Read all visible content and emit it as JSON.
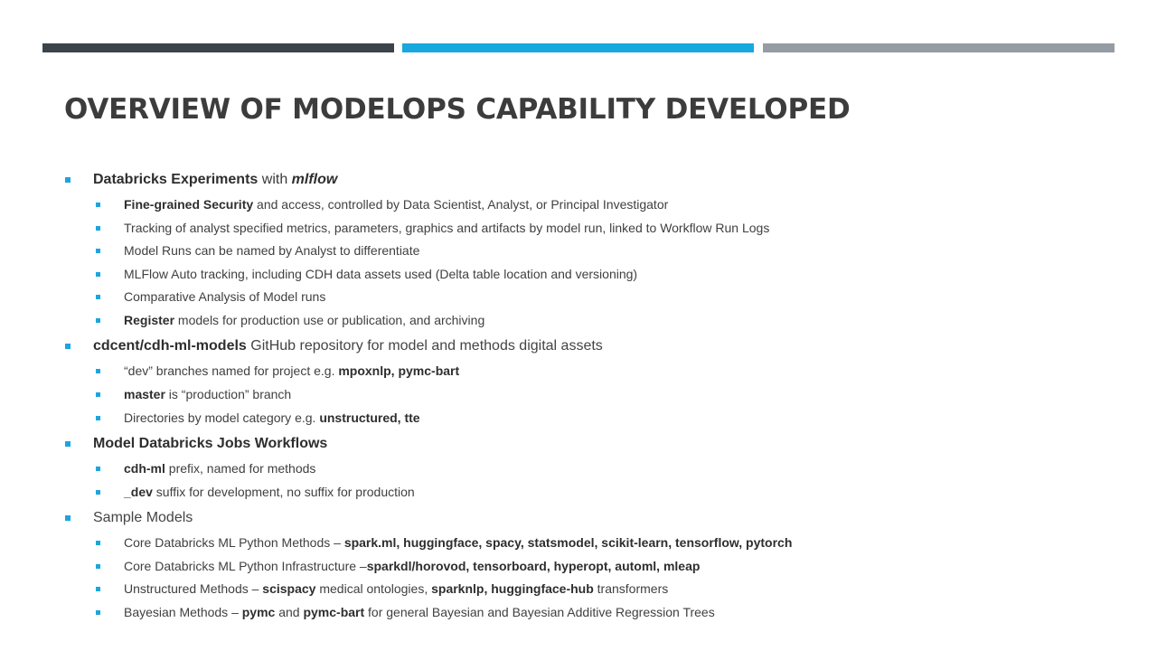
{
  "slide": {
    "title": "OVERVIEW OF MODELOPS CAPABILITY DEVELOPED",
    "accent_colors": [
      "#3d4449",
      "#17a8e0",
      "#959ca3"
    ],
    "bullet_color": "#1aa6de"
  },
  "sections": [
    {
      "heading": {
        "bold": "Databricks Experiments",
        "rest": " with ",
        "em": "mlflow"
      },
      "items": [
        {
          "bold": "Fine-grained Security",
          "rest": " and access, controlled by Data Scientist, Analyst, or Principal Investigator"
        },
        {
          "rest": "Tracking of analyst specified metrics, parameters, graphics and artifacts by model run, linked to Workflow Run Logs"
        },
        {
          "rest": "Model Runs can be named by Analyst to differentiate"
        },
        {
          "rest": "MLFlow Auto tracking, including  CDH data assets used (Delta table location and versioning)"
        },
        {
          "rest": "Comparative Analysis of Model runs"
        },
        {
          "bold": "Register",
          "rest": " models for production use or publication, and archiving"
        }
      ]
    },
    {
      "heading": {
        "bold": "cdcent/cdh-ml-models",
        "rest": " GitHub repository for model and methods digital assets"
      },
      "items": [
        {
          "pre": "“dev” branches named for project e.g. ",
          "bold": "mpoxnlp, pymc-bart"
        },
        {
          "bold": "master",
          "rest": " is “production” branch"
        },
        {
          "pre": "Directories by model category e.g. ",
          "bold": "unstructured, tte"
        }
      ]
    },
    {
      "heading": {
        "bold": "Model Databricks Jobs Workflows"
      },
      "items": [
        {
          "bold": "cdh-ml",
          "rest": " prefix, named for methods"
        },
        {
          "bold": "_dev",
          "rest": " suffix for development, no suffix for production"
        }
      ]
    },
    {
      "heading": {
        "rest": "Sample Models"
      },
      "items": [
        {
          "pre": "Core Databricks ML Python Methods – ",
          "bold": "spark.ml, huggingface, spacy, statsmodel, scikit-learn, tensorflow, pytorch"
        },
        {
          "pre": "Core Databricks ML Python Infrastructure –",
          "bold": "sparkdl/horovod, tensorboard, hyperopt, automl, mleap"
        },
        {
          "pre": "Unstructured Methods – ",
          "bold": "scispacy",
          "mid": " medical ontologies, ",
          "bold2": "sparknlp, huggingface-hub",
          "rest": " transformers"
        },
        {
          "pre": "Bayesian Methods – ",
          "bold": "pymc",
          "mid": " and ",
          "bold2": "pymc-bart",
          "rest": " for general Bayesian and Bayesian Additive Regression Trees"
        }
      ]
    }
  ]
}
